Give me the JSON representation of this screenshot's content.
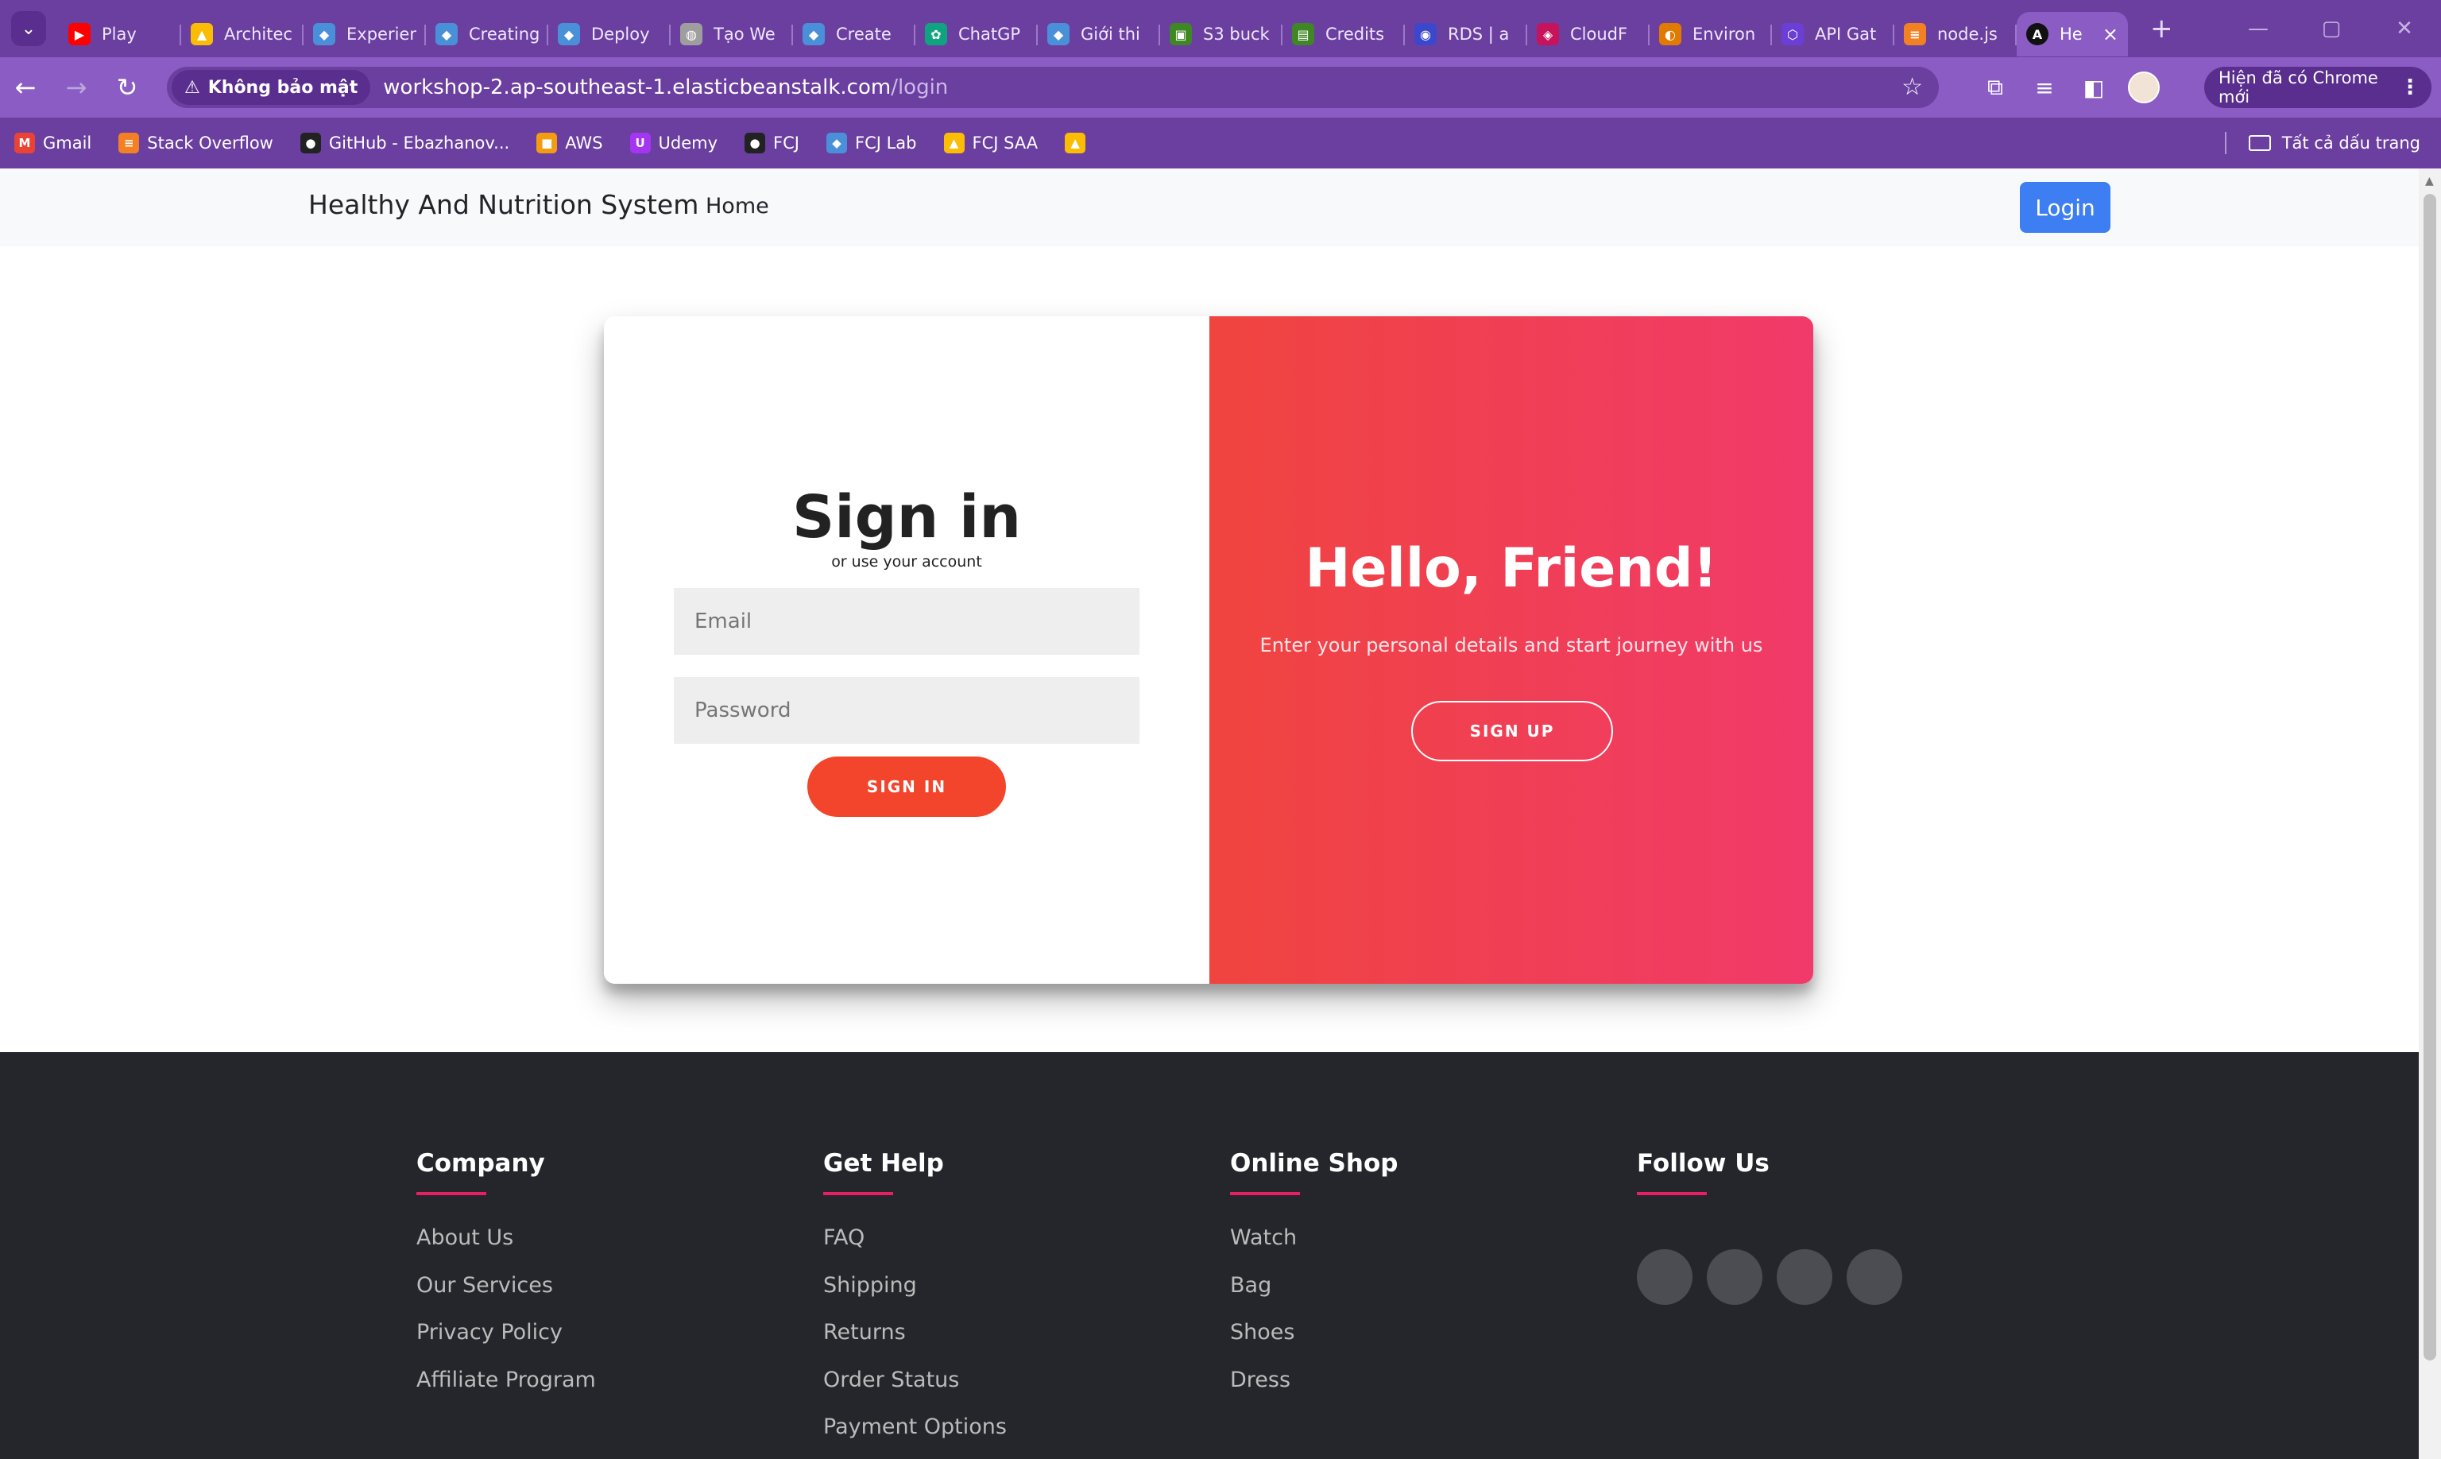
{
  "browser": {
    "tabs": [
      {
        "title": "Play",
        "icon": "youtube-icon",
        "color": "#ff0000"
      },
      {
        "title": "Architec",
        "icon": "drive-icon",
        "color": "#fbbc04"
      },
      {
        "title": "Experien",
        "icon": "shield-icon",
        "color": "#4a90d9"
      },
      {
        "title": "Creating",
        "icon": "shield-icon",
        "color": "#4a90d9"
      },
      {
        "title": "Deploy",
        "icon": "shield-icon",
        "color": "#4a90d9"
      },
      {
        "title": "Tạo We",
        "icon": "globe-icon",
        "color": "#9e9e9e"
      },
      {
        "title": "Create",
        "icon": "shield-icon",
        "color": "#4a90d9"
      },
      {
        "title": "ChatGP",
        "icon": "chatgpt-icon",
        "color": "#10a37f"
      },
      {
        "title": "Giới thi",
        "icon": "shield-icon",
        "color": "#4a90d9"
      },
      {
        "title": "S3 buck",
        "icon": "s3-icon",
        "color": "#3f8624"
      },
      {
        "title": "Credits",
        "icon": "credits-icon",
        "color": "#3f8624"
      },
      {
        "title": "RDS | a",
        "icon": "rds-icon",
        "color": "#3b48cc"
      },
      {
        "title": "CloudF",
        "icon": "cloudfront-icon",
        "color": "#c7135b"
      },
      {
        "title": "Environ",
        "icon": "beanstalk-icon",
        "color": "#e07b00"
      },
      {
        "title": "API Gat",
        "icon": "apigateway-icon",
        "color": "#6b3fd6"
      },
      {
        "title": "node.js",
        "icon": "stackoverflow-icon",
        "color": "#f48024"
      }
    ],
    "active_tab": {
      "title": "He",
      "icon": "angular-icon",
      "color": "#111111"
    },
    "security_label": "Không bảo mật",
    "url_host": "workshop-2.ap-southeast-1.elasticbeanstalk.com",
    "url_path": "/login",
    "update_label": "Hiện đã có Chrome mới",
    "bookmarks": [
      {
        "label": "Gmail",
        "icon": "gmail-icon",
        "color": "#ea4335"
      },
      {
        "label": "Stack Overflow",
        "icon": "stackoverflow-icon",
        "color": "#f48024"
      },
      {
        "label": "GitHub - Ebazhanov...",
        "icon": "github-icon",
        "color": "#222222"
      },
      {
        "label": "AWS",
        "icon": "aws-icon",
        "color": "#f39c12"
      },
      {
        "label": "Udemy",
        "icon": "udemy-icon",
        "color": "#a435f0"
      },
      {
        "label": "FCJ",
        "icon": "github-icon",
        "color": "#222222"
      },
      {
        "label": "FCJ Lab",
        "icon": "shield-icon",
        "color": "#4a90d9"
      },
      {
        "label": "FCJ SAA",
        "icon": "drive-icon",
        "color": "#fbbc04"
      },
      {
        "label": "",
        "icon": "drive-icon",
        "color": "#fbbc04"
      }
    ],
    "all_bookmarks_label": "Tất cả dấu trang"
  },
  "app": {
    "brand": "Healthy And Nutrition System",
    "nav_home": "Home",
    "login_button": "Login"
  },
  "signin": {
    "title": "Sign in",
    "subtitle": "or use your account",
    "email_placeholder": "Email",
    "password_placeholder": "Password",
    "button": "SIGN IN"
  },
  "overlay": {
    "title": "Hello, Friend!",
    "text": "Enter your personal details and start journey with us",
    "button": "SIGN UP"
  },
  "footer": {
    "columns": [
      {
        "heading": "Company",
        "links": [
          "About Us",
          "Our Services",
          "Privacy Policy",
          "Affiliate Program"
        ]
      },
      {
        "heading": "Get Help",
        "links": [
          "FAQ",
          "Shipping",
          "Returns",
          "Order Status",
          "Payment Options"
        ]
      },
      {
        "heading": "Online Shop",
        "links": [
          "Watch",
          "Bag",
          "Shoes",
          "Dress"
        ]
      }
    ],
    "follow_heading": "Follow Us",
    "socials": [
      "social-icon-1",
      "social-icon-2",
      "social-icon-3",
      "social-icon-4"
    ]
  },
  "colors": {
    "accent_blue": "#3d7ef2",
    "signin_button": "#f2452b",
    "overlay_gradient_start": "#f0443f",
    "overlay_gradient_end": "#f13a6a",
    "footer_bg": "#24262b",
    "footer_underline": "#e91e63"
  }
}
